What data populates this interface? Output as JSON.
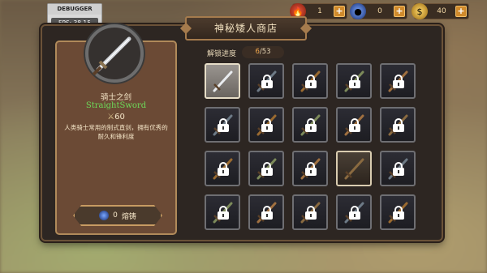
{
  "debugger": {
    "title": "DEBUGGER",
    "fps": "FPS: 38.15"
  },
  "resources": [
    {
      "icon": "fire-gem-icon",
      "value": "1",
      "color": "#c0392b"
    },
    {
      "icon": "blue-orb-icon",
      "value": "0",
      "color": "#2c5fd6"
    },
    {
      "icon": "gold-coins-icon",
      "value": "40",
      "color": "#e0a526"
    }
  ],
  "shop": {
    "title": "神秘矮人商店"
  },
  "item": {
    "name": "骑士之剑",
    "english_name": "StraightSword",
    "attack": "60",
    "description": "人类骑士常用的制式直剑，拥有优秀的耐久和锋利度"
  },
  "forge": {
    "cost": "0",
    "label": "熔铸"
  },
  "progress": {
    "label": "解锁进度",
    "current": "6",
    "total": "/53"
  },
  "grid": {
    "rows": [
      [
        "selected",
        "locked",
        "locked",
        "locked",
        "locked"
      ],
      [
        "locked",
        "locked",
        "locked",
        "locked",
        "locked"
      ],
      [
        "locked",
        "locked",
        "locked",
        "unlocked",
        "locked"
      ],
      [
        "locked",
        "locked",
        "locked",
        "locked",
        "locked"
      ]
    ]
  }
}
